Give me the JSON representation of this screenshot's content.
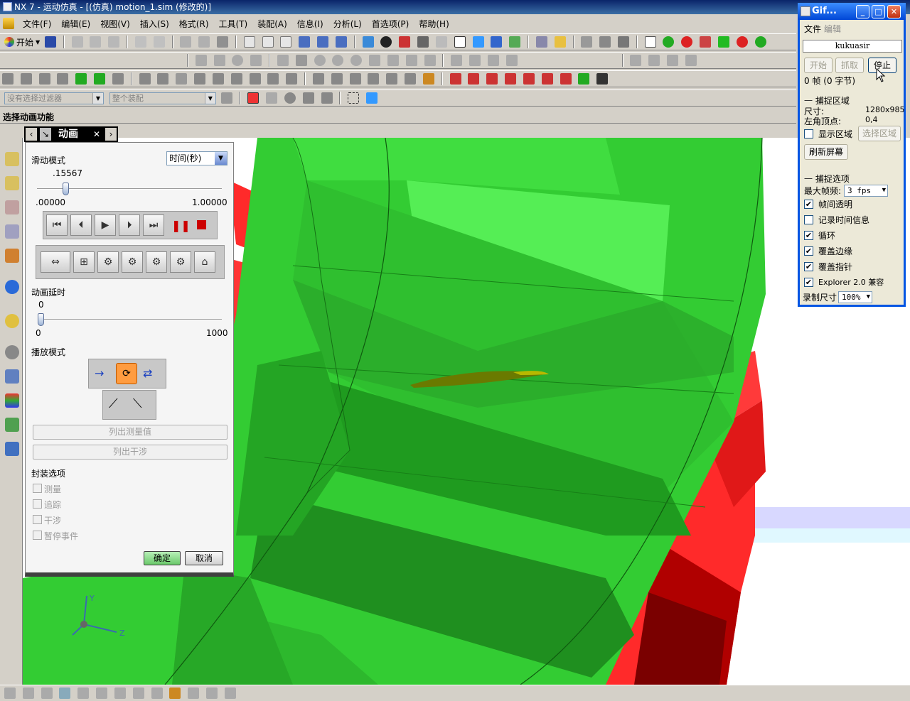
{
  "app": {
    "title": "NX 7 - 运动仿真 - [(仿真) motion_1.sim (修改的)]"
  },
  "menubar": {
    "items": [
      "文件(F)",
      "编辑(E)",
      "视图(V)",
      "插入(S)",
      "格式(R)",
      "工具(T)",
      "装配(A)",
      "信息(I)",
      "分析(L)",
      "首选项(P)",
      "帮助(H)"
    ]
  },
  "toolbar": {
    "start_label": "开始",
    "filter_placeholder": "没有选择过滤器",
    "assembly_placeholder": "整个装配"
  },
  "cue_line": "选择动画功能",
  "animation_dialog": {
    "tab_title": "动画",
    "slide_mode_label": "滑动模式",
    "slide_mode_value": "时间(秒)",
    "time_value": ".15567",
    "time_fraction": 0.15567,
    "time_min": ".00000",
    "time_max": "1.00000",
    "delay_label": "动画延时",
    "delay_value": "0",
    "delay_min": "0",
    "delay_max": "1000",
    "playback_label": "播放模式",
    "list_measurements": "列出测量值",
    "list_interference": "列出干涉",
    "envelope_label": "封装选项",
    "envelope_options": [
      "测量",
      "追踪",
      "干涉",
      "暂停事件"
    ],
    "ok_label": "确定",
    "cancel_label": "取消"
  },
  "gif_capture": {
    "title": "Gif...",
    "menu": [
      "文件",
      "编辑"
    ],
    "user_name": "kukuasir",
    "btn_start": "开始",
    "btn_capture": "抓取",
    "btn_stop": "停止",
    "status": "0 帧 (0 字节)",
    "capture_area_label": "捕捉区域",
    "size_label": "尺寸:",
    "size_value": "1280x985",
    "corner_label": "左角顶点:",
    "corner_value": "0,4",
    "show_area_label": "显示区域",
    "select_area_btn": "选择区域",
    "refresh_btn": "刷新屏幕",
    "capture_options_label": "捕捉选项",
    "max_fps_label": "最大帧频:",
    "max_fps_value": "3 fps",
    "options": [
      {
        "label": "帧间透明",
        "checked": true
      },
      {
        "label": "记录时间信息",
        "checked": false
      },
      {
        "label": "循环",
        "checked": true
      },
      {
        "label": "覆盖边缘",
        "checked": true
      },
      {
        "label": "覆盖指针",
        "checked": true
      },
      {
        "label": "Explorer 2.0 兼容",
        "checked": true
      }
    ],
    "record_size_label": "录制尺寸",
    "record_size_value": "100%"
  },
  "axis_triad": {
    "y": "Y",
    "z": "Z"
  },
  "colors": {
    "green_light": "#33cc33",
    "green_dark": "#1f8f1f",
    "red": "#ff2a2a",
    "red_dark": "#9a0000",
    "xp_blue": "#0054e3"
  }
}
